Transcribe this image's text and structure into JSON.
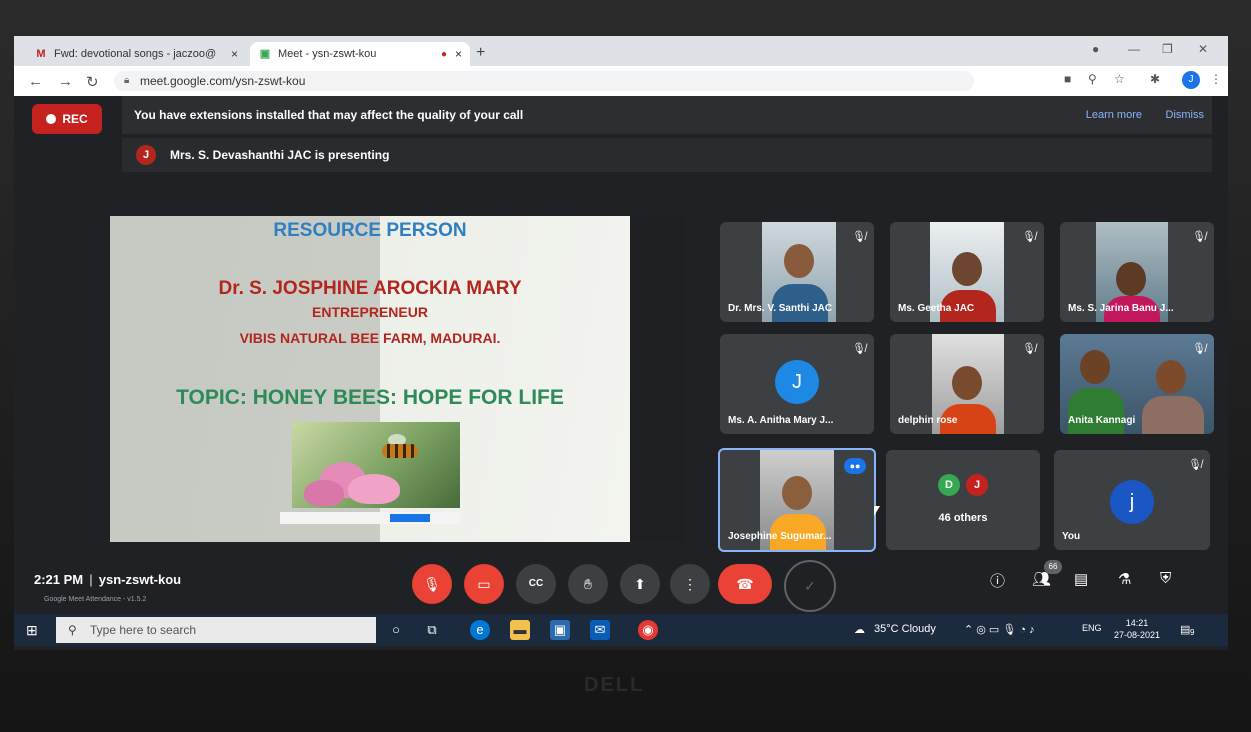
{
  "browser": {
    "tabs": [
      {
        "icon": "M",
        "label": "Fwd: devotional songs - jaczoo@",
        "close": "×"
      },
      {
        "icon": "▣",
        "label": "Meet - ysn-zswt-kou",
        "close": "×"
      }
    ],
    "new_tab": "+",
    "url": "meet.google.com/ysn-zswt-kou",
    "profile_initial": "J"
  },
  "meet": {
    "rec_label": "REC",
    "notice": {
      "text": "You have extensions installed that may affect the quality of your call",
      "learn_more": "Learn more",
      "dismiss": "Dismiss"
    },
    "presenting": {
      "avatar_initial": "J",
      "text": "Mrs. S. Devashanthi JAC is presenting"
    },
    "slide": {
      "title": "RESOURCE PERSON",
      "name": "Dr. S. JOSPHINE AROCKIA MARY",
      "role": "ENTREPRENEUR",
      "farm": "VIBIS NATURAL BEE FARM, MADURAI.",
      "topic": "TOPIC: HONEY BEES: HOPE FOR LIFE"
    },
    "participants": [
      {
        "name": "Dr. Mrs. V. Santhi JAC",
        "muted": true
      },
      {
        "name": "Ms. Geetha JAC",
        "muted": true
      },
      {
        "name": "Ms. S. Jarina Banu J...",
        "muted": true
      },
      {
        "name": "Ms. A. Anitha Mary J...",
        "muted": true,
        "avatar": "J",
        "avatar_color": "#1e88e5"
      },
      {
        "name": "delphin rose",
        "muted": true
      },
      {
        "name": "Anita Kannagi",
        "muted": true
      },
      {
        "name": "Josephine Sugumar...",
        "speaking": true
      }
    ],
    "others": {
      "initials": [
        "D",
        "J"
      ],
      "colors": [
        "#34a853",
        "#c5221f"
      ],
      "label": "46 others"
    },
    "self": {
      "name": "You",
      "avatar": "j",
      "avatar_color": "#1a56c4",
      "muted": true
    },
    "bottom": {
      "time": "2:21 PM",
      "separator": "|",
      "code": "ysn-zswt-kou",
      "extension": "Google Meet Attendance - v1.5.2",
      "people_count": "66"
    }
  },
  "taskbar": {
    "search_placeholder": "Type here to search",
    "weather": "35°C  Cloudy",
    "lang": "ENG",
    "time": "14:21",
    "date": "27-08-2021",
    "notif": "9"
  },
  "brand": "DELL"
}
